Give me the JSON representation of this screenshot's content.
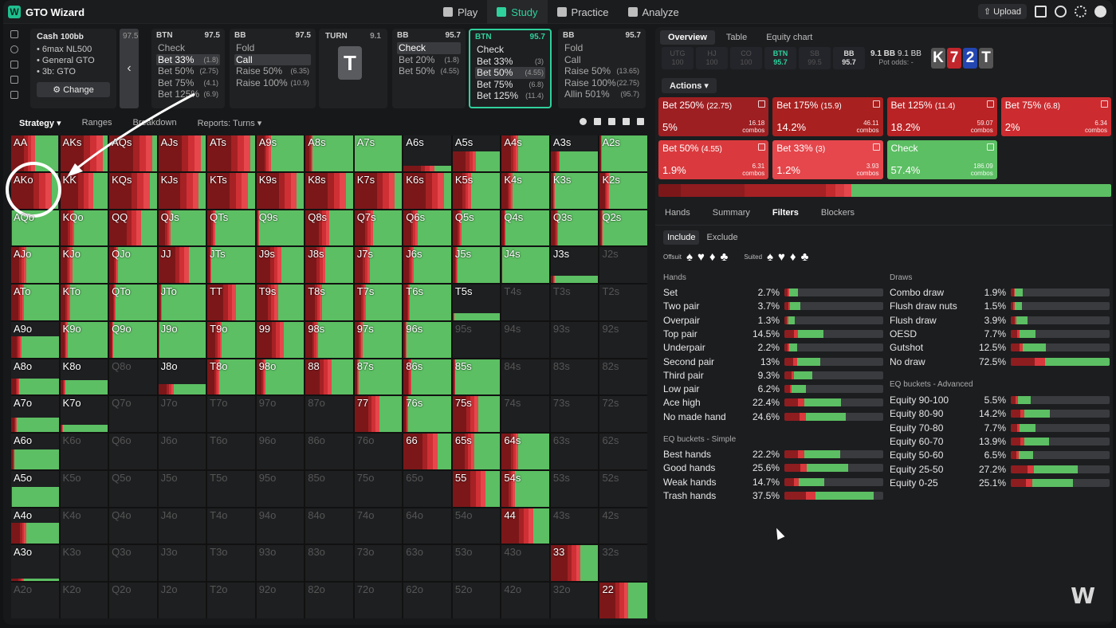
{
  "app": {
    "title": "GTO Wizard",
    "upload": "Upload"
  },
  "nav": [
    {
      "label": "Play",
      "icon": "spade-icon"
    },
    {
      "label": "Study",
      "icon": "graduation-icon",
      "active": true
    },
    {
      "label": "Practice",
      "icon": "gamepad-icon"
    },
    {
      "label": "Analyze",
      "icon": "bulb-icon"
    }
  ],
  "info": {
    "title": "Cash",
    "stake": "100bb",
    "items": [
      "6max NL500",
      "General GTO",
      "3b: GTO"
    ],
    "change": "Change"
  },
  "collapsed_card": {
    "value": "97.5"
  },
  "cards": [
    {
      "pos": "BTN",
      "stack": "97.5",
      "rows": [
        {
          "a": "Check",
          "s": ""
        },
        {
          "a": "Bet 33%",
          "s": "(1.8)",
          "sel": true
        },
        {
          "a": "Bet 50%",
          "s": "(2.75)"
        },
        {
          "a": "Bet 75%",
          "s": "(4.1)"
        },
        {
          "a": "Bet 125%",
          "s": "(6.9)"
        }
      ]
    },
    {
      "pos": "BB",
      "stack": "97.5",
      "rows": [
        {
          "a": "Fold",
          "s": ""
        },
        {
          "a": "Call",
          "s": "",
          "sel": true
        },
        {
          "a": "Raise 50%",
          "s": "(6.35)"
        },
        {
          "a": "Raise 100%",
          "s": "(10.9)"
        }
      ]
    },
    {
      "pos": "BB",
      "stack": "95.7",
      "rows": [
        {
          "a": "Check",
          "s": "",
          "sel": true
        },
        {
          "a": "Bet 20%",
          "s": "(1.8)"
        },
        {
          "a": "Bet 50%",
          "s": "(4.55)"
        }
      ]
    },
    {
      "pos": "BTN",
      "stack": "95.7",
      "active": true,
      "rows": [
        {
          "a": "Check",
          "s": ""
        },
        {
          "a": "Bet 33%",
          "s": "(3)"
        },
        {
          "a": "Bet 50%",
          "s": "(4.55)",
          "sel": true
        },
        {
          "a": "Bet 75%",
          "s": "(6.8)"
        },
        {
          "a": "Bet 125%",
          "s": "(11.4)"
        }
      ]
    },
    {
      "pos": "BB",
      "stack": "95.7",
      "rows": [
        {
          "a": "Fold",
          "s": ""
        },
        {
          "a": "Call",
          "s": ""
        },
        {
          "a": "Raise 50%",
          "s": "(13.65)"
        },
        {
          "a": "Raise 100%",
          "s": "(22.75)"
        },
        {
          "a": "Allin 501%",
          "s": "(95.7)"
        }
      ]
    }
  ],
  "turn": {
    "label": "TURN",
    "value": "9.1",
    "card": "T"
  },
  "toolbar": {
    "strategy": "Strategy",
    "ranges": "Ranges",
    "breakdown": "Breakdown",
    "reports": "Reports: Turns"
  },
  "matrix_labels": [
    [
      "AA",
      "AKs",
      "AQs",
      "AJs",
      "ATs",
      "A9s",
      "A8s",
      "A7s",
      "A6s",
      "A5s",
      "A4s",
      "A3s",
      "A2s"
    ],
    [
      "AKo",
      "KK",
      "KQs",
      "KJs",
      "KTs",
      "K9s",
      "K8s",
      "K7s",
      "K6s",
      "K5s",
      "K4s",
      "K3s",
      "K2s"
    ],
    [
      "AQo",
      "KQo",
      "QQ",
      "QJs",
      "QTs",
      "Q9s",
      "Q8s",
      "Q7s",
      "Q6s",
      "Q5s",
      "Q4s",
      "Q3s",
      "Q2s"
    ],
    [
      "AJo",
      "KJo",
      "QJo",
      "JJ",
      "JTs",
      "J9s",
      "J8s",
      "J7s",
      "J6s",
      "J5s",
      "J4s",
      "J3s",
      "J2s"
    ],
    [
      "ATo",
      "KTo",
      "QTo",
      "JTo",
      "TT",
      "T9s",
      "T8s",
      "T7s",
      "T6s",
      "T5s",
      "T4s",
      "T3s",
      "T2s"
    ],
    [
      "A9o",
      "K9o",
      "Q9o",
      "J9o",
      "T9o",
      "99",
      "98s",
      "97s",
      "96s",
      "95s",
      "94s",
      "93s",
      "92s"
    ],
    [
      "A8o",
      "K8o",
      "Q8o",
      "J8o",
      "T8o",
      "98o",
      "88",
      "87s",
      "86s",
      "85s",
      "84s",
      "83s",
      "82s"
    ],
    [
      "A7o",
      "K7o",
      "Q7o",
      "J7o",
      "T7o",
      "97o",
      "87o",
      "77",
      "76s",
      "75s",
      "74s",
      "73s",
      "72s"
    ],
    [
      "A6o",
      "K6o",
      "Q6o",
      "J6o",
      "T6o",
      "96o",
      "86o",
      "76o",
      "66",
      "65s",
      "64s",
      "63s",
      "62s"
    ],
    [
      "A5o",
      "K5o",
      "Q5o",
      "J5o",
      "T5o",
      "95o",
      "85o",
      "75o",
      "65o",
      "55",
      "54s",
      "53s",
      "52s"
    ],
    [
      "A4o",
      "K4o",
      "Q4o",
      "J4o",
      "T4o",
      "94o",
      "84o",
      "74o",
      "64o",
      "54o",
      "44",
      "43s",
      "42s"
    ],
    [
      "A3o",
      "K3o",
      "Q3o",
      "J3o",
      "T3o",
      "93o",
      "83o",
      "73o",
      "63o",
      "53o",
      "43o",
      "33",
      "32s"
    ],
    [
      "A2o",
      "K2o",
      "Q2o",
      "J2o",
      "T2o",
      "92o",
      "82o",
      "72o",
      "62o",
      "52o",
      "42o",
      "32o",
      "22"
    ]
  ],
  "overview": {
    "tabs": [
      "Overview",
      "Table",
      "Equity chart"
    ],
    "seats": [
      {
        "p": "UTG",
        "v": "100"
      },
      {
        "p": "HJ",
        "v": "100"
      },
      {
        "p": "CO",
        "v": "100"
      },
      {
        "p": "BTN",
        "v": "95.7"
      },
      {
        "p": "SB",
        "v": "99.5"
      },
      {
        "p": "BB",
        "v": "95.7"
      }
    ],
    "pot": "9.1 BB",
    "pot2": "9.1 BB",
    "pot_odds_label": "Pot odds:",
    "pot_odds": "-",
    "board": [
      "K",
      "7",
      "2",
      "T"
    ],
    "board_colors": [
      "#555",
      "#c0262b",
      "#2346b0",
      "#555"
    ]
  },
  "actions_label": "Actions",
  "action_cards": [
    {
      "name": "Bet 250%",
      "size": "(22.75)",
      "pct": "5%",
      "combos": "16.18",
      "color": "#9e1f22"
    },
    {
      "name": "Bet 175%",
      "size": "(15.9)",
      "pct": "14.2%",
      "combos": "46.11",
      "color": "#a8201f"
    },
    {
      "name": "Bet 125%",
      "size": "(11.4)",
      "pct": "18.2%",
      "combos": "59.07",
      "color": "#b92325"
    },
    {
      "name": "Bet 75%",
      "size": "(6.8)",
      "pct": "2%",
      "combos": "6.34",
      "color": "#cc2c30"
    },
    {
      "name": "Bet 50%",
      "size": "(4.55)",
      "pct": "1.9%",
      "combos": "6.31",
      "color": "#da3a3e"
    },
    {
      "name": "Bet 33%",
      "size": "(3)",
      "pct": "1.2%",
      "combos": "3.93",
      "color": "#e5474c"
    },
    {
      "name": "Check",
      "size": "",
      "pct": "57.4%",
      "combos": "186.09",
      "color": "#5cbf63"
    }
  ],
  "combos_label": "combos",
  "bottom_tabs": [
    "Hands",
    "Summary",
    "Filters",
    "Blockers"
  ],
  "filters": {
    "include": "Include",
    "exclude": "Exclude",
    "offsuit": "Offsuit",
    "suited": "Suited"
  },
  "hands_title": "Hands",
  "hands": [
    {
      "n": "Set",
      "p": "2.7%",
      "v": 2.7
    },
    {
      "n": "Two pair",
      "p": "3.7%",
      "v": 3.7
    },
    {
      "n": "Overpair",
      "p": "1.3%",
      "v": 1.3
    },
    {
      "n": "Top pair",
      "p": "14.5%",
      "v": 14.5
    },
    {
      "n": "Underpair",
      "p": "2.2%",
      "v": 2.2
    },
    {
      "n": "Second pair",
      "p": "13%",
      "v": 13
    },
    {
      "n": "Third pair",
      "p": "9.3%",
      "v": 9.3
    },
    {
      "n": "Low pair",
      "p": "6.2%",
      "v": 6.2
    },
    {
      "n": "Ace high",
      "p": "22.4%",
      "v": 22.4
    },
    {
      "n": "No made hand",
      "p": "24.6%",
      "v": 24.6
    }
  ],
  "eq_simple_title": "EQ buckets - Simple",
  "eq_simple": [
    {
      "n": "Best hands",
      "p": "22.2%",
      "v": 22.2
    },
    {
      "n": "Good hands",
      "p": "25.6%",
      "v": 25.6
    },
    {
      "n": "Weak hands",
      "p": "14.7%",
      "v": 14.7
    },
    {
      "n": "Trash hands",
      "p": "37.5%",
      "v": 37.5
    }
  ],
  "draws_title": "Draws",
  "draws": [
    {
      "n": "Combo draw",
      "p": "1.9%",
      "v": 1.9
    },
    {
      "n": "Flush draw nuts",
      "p": "1.5%",
      "v": 1.5
    },
    {
      "n": "Flush draw",
      "p": "3.9%",
      "v": 3.9
    },
    {
      "n": "OESD",
      "p": "7.7%",
      "v": 7.7
    },
    {
      "n": "Gutshot",
      "p": "12.5%",
      "v": 12.5
    },
    {
      "n": "No draw",
      "p": "72.5%",
      "v": 72.5
    }
  ],
  "eq_adv_title": "EQ buckets - Advanced",
  "eq_adv": [
    {
      "n": "Equity 90-100",
      "p": "5.5%",
      "v": 5.5
    },
    {
      "n": "Equity 80-90",
      "p": "14.2%",
      "v": 14.2
    },
    {
      "n": "Equity 70-80",
      "p": "7.7%",
      "v": 7.7
    },
    {
      "n": "Equity 60-70",
      "p": "13.9%",
      "v": 13.9
    },
    {
      "n": "Equity 50-60",
      "p": "6.5%",
      "v": 6.5
    },
    {
      "n": "Equity 25-50",
      "p": "27.2%",
      "v": 27.2
    },
    {
      "n": "Equity 0-25",
      "p": "25.1%",
      "v": 25.1
    }
  ]
}
